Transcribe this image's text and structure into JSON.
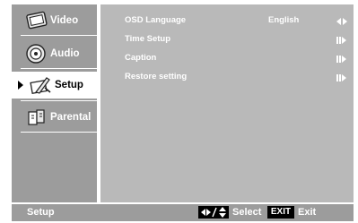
{
  "sidebar": {
    "items": [
      {
        "label": "Video",
        "icon": "tv-icon",
        "active": false
      },
      {
        "label": "Audio",
        "icon": "speaker-icon",
        "active": false
      },
      {
        "label": "Setup",
        "icon": "setup-tools-icon",
        "active": true
      },
      {
        "label": "Parental",
        "icon": "parental-lock-icon",
        "active": false
      }
    ]
  },
  "settings": {
    "rows": [
      {
        "label": "OSD Language",
        "value": "English",
        "control": "left-right-arrows-icon"
      },
      {
        "label": "Time Setup",
        "value": "",
        "control": "enter-arrow-icon"
      },
      {
        "label": "Caption",
        "value": "",
        "control": "enter-arrow-icon"
      },
      {
        "label": "Restore setting",
        "value": "",
        "control": "enter-arrow-icon"
      }
    ]
  },
  "bottom": {
    "title": "Setup",
    "select_label": "Select",
    "exit_key": "EXIT",
    "exit_label": "Exit"
  },
  "colors": {
    "sidebar": "#9c9c9c",
    "content": "#b9b9b9",
    "active_item": "#ffffff",
    "text": "#ffffff"
  }
}
